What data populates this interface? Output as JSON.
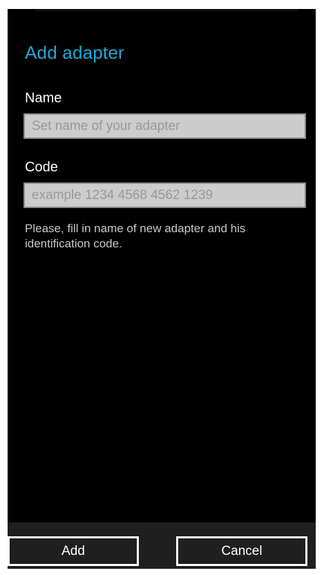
{
  "page": {
    "title": "Add adapter"
  },
  "form": {
    "name_label": "Name",
    "name_value": "",
    "name_placeholder": "Set name of your adapter",
    "code_label": "Code",
    "code_value": "",
    "code_placeholder": "example 1234 4568 4562 1239",
    "hint": "Please, fill in name of new adapter and his identification code."
  },
  "app_bar": {
    "add_label": "Add",
    "cancel_label": "Cancel"
  },
  "colors": {
    "accent": "#1fa9d8",
    "background": "#000000",
    "input_background": "#cccccc",
    "app_bar_background": "#1f1f1f"
  }
}
